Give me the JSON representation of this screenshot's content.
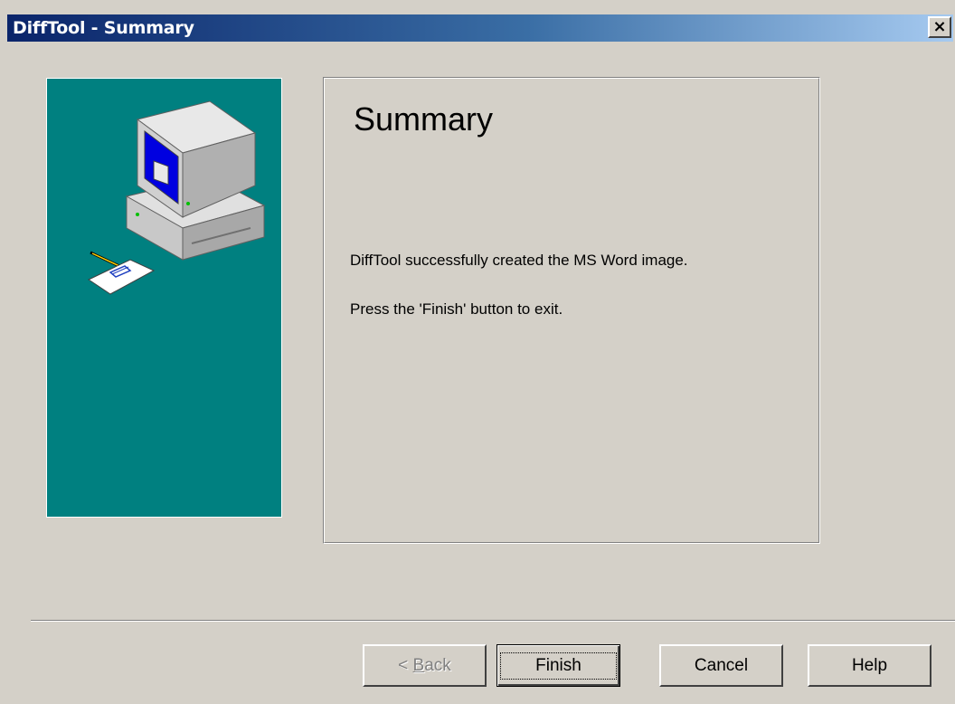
{
  "window": {
    "title": "DiffTool - Summary",
    "close_label": "×"
  },
  "content": {
    "heading": "Summary",
    "message_created": "DiffTool successfully created the MS Word image.",
    "message_exit": "Press the 'Finish' button to exit."
  },
  "buttons": {
    "back_prefix": "< ",
    "back_accel": "B",
    "back_rest": "ack",
    "finish": "Finish",
    "cancel": "Cancel",
    "help": "Help"
  },
  "colors": {
    "panel_background": "#008080",
    "titlebar_start": "#0a246a",
    "titlebar_end": "#a6caf0"
  }
}
